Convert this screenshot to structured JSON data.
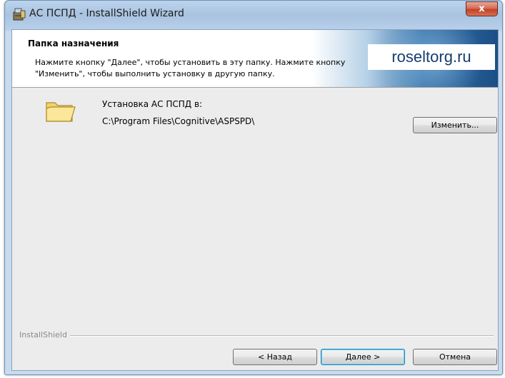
{
  "window": {
    "title": "АС ПСПД - InstallShield Wizard",
    "close_label": "x"
  },
  "banner": {
    "title": "Папка назначения",
    "description_line1": "Нажмите кнопку \"Далее\", чтобы установить в эту папку. Нажмите кнопку",
    "description_line2": "\"Изменить\", чтобы выполнить установку в другую папку.",
    "watermark": "roseltorg.ru"
  },
  "install": {
    "label": "Установка АС ПСПД в:",
    "path": "C:\\Program Files\\Cognitive\\ASPSPD\\",
    "change_button": "Изменить..."
  },
  "footer": {
    "brand": "InstallShield",
    "back_button": "< Назад",
    "next_button": "Далее >",
    "cancel_button": "Отмена"
  },
  "icons": {
    "app": "installer-icon",
    "folder": "folder-icon",
    "close": "close-icon"
  }
}
